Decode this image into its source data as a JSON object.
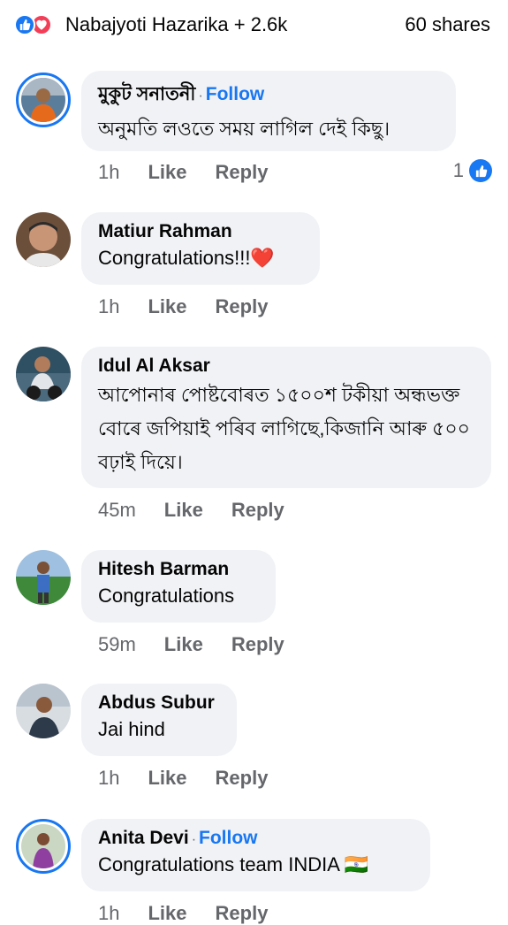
{
  "header": {
    "reactor_name": "Nabajyoti Hazarika + 2.6k",
    "shares": "60 shares"
  },
  "comments": [
    {
      "name": "মুকুট সনাতনী",
      "follow": "Follow",
      "text": "অনুমতি লওতে সময় লাগিল দেই কিছু।",
      "time": "1h",
      "like": "Like",
      "reply": "Reply",
      "likes": "1"
    },
    {
      "name": "Matiur Rahman",
      "text": "Congratulations!!!❤️",
      "time": "1h",
      "like": "Like",
      "reply": "Reply"
    },
    {
      "name": "Idul Al Aksar",
      "text": "আপোনাৰ পোষ্টবোৰত ১৫০০শ টকীয়া অন্ধভক্ত বোৰে জপিয়াই পৰিব লাগিছে,কিজানি আৰু ৫০০ বঢ়াই দিয়ে।",
      "time": "45m",
      "like": "Like",
      "reply": "Reply"
    },
    {
      "name": "Hitesh Barman",
      "text": "Congratulations",
      "time": "59m",
      "like": "Like",
      "reply": "Reply"
    },
    {
      "name": "Abdus Subur",
      "text": "Jai hind",
      "time": "1h",
      "like": "Like",
      "reply": "Reply"
    },
    {
      "name": "Anita Devi",
      "follow": "Follow",
      "text": "Congratulations team INDIA 🇮🇳",
      "time": "1h",
      "like": "Like",
      "reply": "Reply"
    }
  ],
  "colors": {
    "accent": "#1877f2",
    "love": "#f33e58",
    "bubble": "#f0f2f5",
    "muted": "#65676b"
  }
}
